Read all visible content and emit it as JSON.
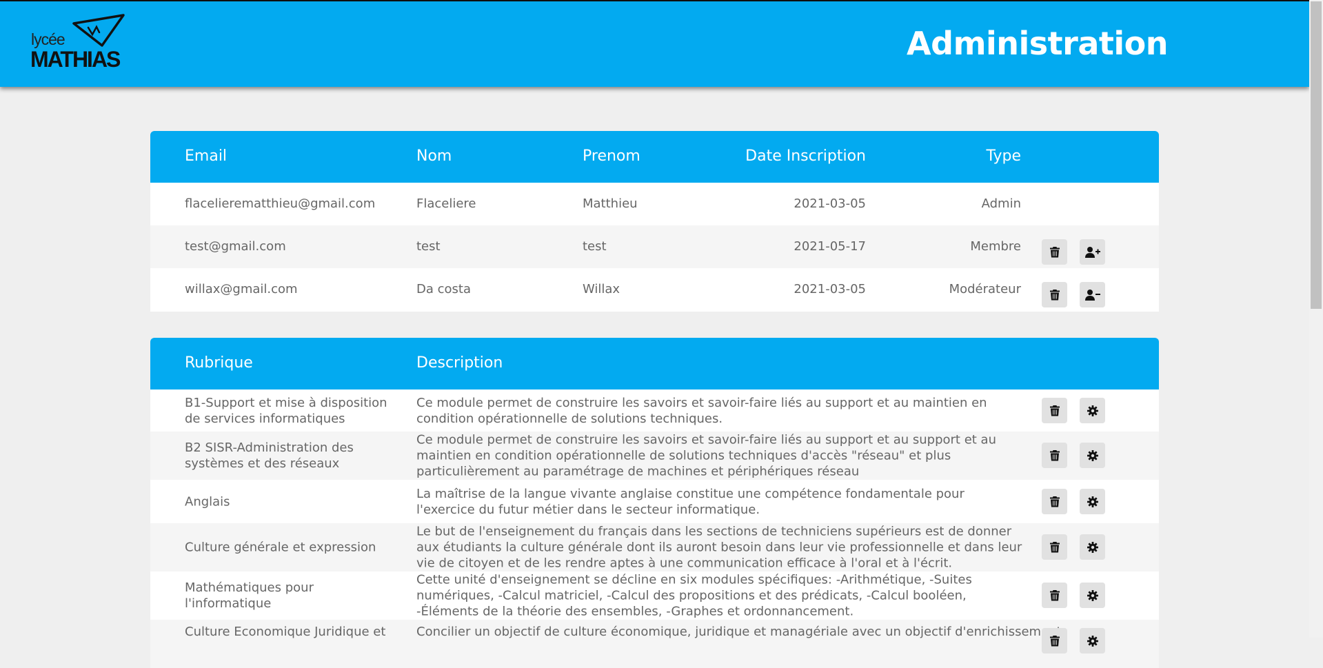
{
  "header": {
    "title": "Administration",
    "logo": {
      "line1": "lycée",
      "line2": "MATHIAS"
    }
  },
  "users": {
    "columns": {
      "email": "Email",
      "nom": "Nom",
      "prenom": "Prenom",
      "date": "Date Inscription",
      "type": "Type"
    },
    "rows": [
      {
        "email": "flacelierematthieu@gmail.com",
        "nom": "Flaceliere",
        "prenom": "Matthieu",
        "date": "2021-03-05",
        "type": "Admin",
        "actions": []
      },
      {
        "email": "test@gmail.com",
        "nom": "test",
        "prenom": "test",
        "date": "2021-05-17",
        "type": "Membre",
        "actions": [
          "trash-icon",
          "user-plus-icon"
        ]
      },
      {
        "email": "willax@gmail.com",
        "nom": "Da costa",
        "prenom": "Willax",
        "date": "2021-03-05",
        "type": "Modérateur",
        "actions": [
          "trash-icon",
          "user-minus-icon"
        ]
      }
    ]
  },
  "rubriques": {
    "columns": {
      "rubrique": "Rubrique",
      "description": "Description"
    },
    "rows": [
      {
        "rubrique": "B1-Support et mise à disposition de services informatiques",
        "description": "Ce module permet de construire les savoirs et savoir-faire liés au support et au maintien en condition opérationnelle de solutions techniques."
      },
      {
        "rubrique": "B2 SISR-Administration des systèmes et des réseaux",
        "description": "Ce module permet de construire les savoirs et savoir-faire liés au support et au support et au maintien en condition opérationnelle de solutions techniques d'accès \"réseau\" et plus particulièrement au paramétrage de machines et périphériques réseau"
      },
      {
        "rubrique": "Anglais",
        "description": "La maîtrise de la langue vivante anglaise constitue une compétence fondamentale pour l'exercice du futur métier dans le secteur informatique."
      },
      {
        "rubrique": "Culture générale et expression",
        "description": "Le but de l'enseignement du français dans les sections de techniciens supérieurs est de donner aux étudiants la culture générale dont ils auront besoin dans leur vie professionnelle et dans leur vie de citoyen et de les rendre aptes à une communication efficace à l'oral et à l'écrit."
      },
      {
        "rubrique": "Mathématiques pour l'informatique",
        "description": "Cette unité d'enseignement se décline en six modules spécifiques: -Arithmétique, -Suites numériques, -Calcul matriciel, -Calcul des propositions et des prédicats, -Calcul booléen, -Éléments de la théorie des ensembles, -Graphes et ordonnancement."
      },
      {
        "rubrique": "Culture Economique Juridique et",
        "description": "Concilier un objectif de culture économique, juridique et managériale avec un objectif d'enrichissement"
      }
    ]
  },
  "colors": {
    "accent": "#03aaf0",
    "page_bg": "#efefef",
    "button_bg": "#e1e1e1"
  }
}
